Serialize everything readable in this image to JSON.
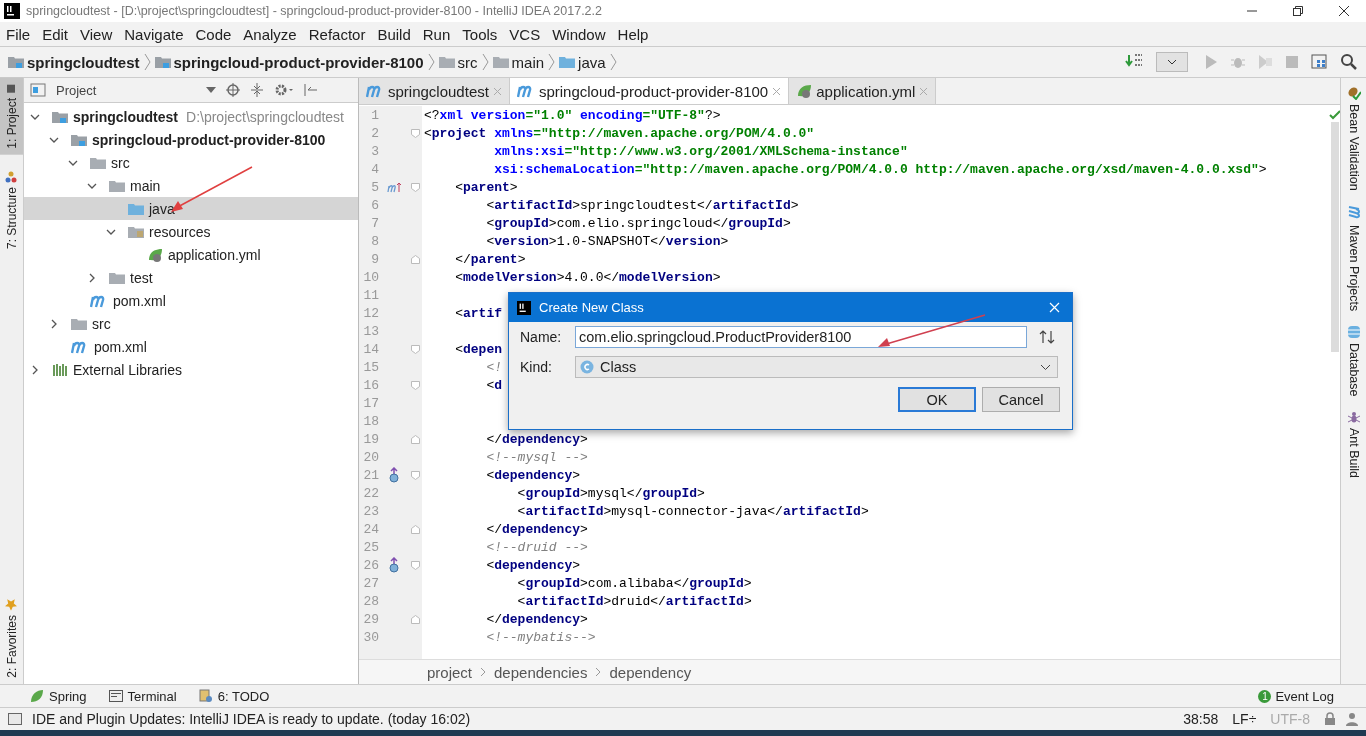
{
  "window": {
    "title": "springcloudtest - [D:\\project\\springcloudtest] - springcloud-product-provider-8100 - IntelliJ IDEA 2017.2.2"
  },
  "menu": [
    "File",
    "Edit",
    "View",
    "Navigate",
    "Code",
    "Analyze",
    "Refactor",
    "Build",
    "Run",
    "Tools",
    "VCS",
    "Window",
    "Help"
  ],
  "breadcrumbs": [
    {
      "label": "springcloudtest",
      "kind": "module"
    },
    {
      "label": "springcloud-product-provider-8100",
      "kind": "module"
    },
    {
      "label": "src",
      "kind": "folder"
    },
    {
      "label": "main",
      "kind": "folder"
    },
    {
      "label": "java",
      "kind": "source"
    }
  ],
  "left_stripe": {
    "top": [
      {
        "label": "1: Project",
        "selected": true,
        "kind": "project"
      },
      {
        "label": "7: Structure",
        "selected": false,
        "kind": "structure"
      }
    ],
    "bottom": [
      {
        "label": "2: Favorites",
        "selected": false,
        "kind": "favorites"
      }
    ]
  },
  "project": {
    "title": "Project",
    "tree": [
      {
        "label": "springcloudtest",
        "kind": "module",
        "path": "D:\\project\\springcloudtest",
        "expanded": true,
        "selected": false,
        "children": [
          {
            "label": "springcloud-product-provider-8100",
            "kind": "module",
            "expanded": true,
            "selected": false,
            "children": [
              {
                "label": "src",
                "kind": "folder",
                "expanded": true,
                "selected": false,
                "children": [
                  {
                    "label": "main",
                    "kind": "folder",
                    "expanded": true,
                    "selected": false,
                    "children": [
                      {
                        "label": "java",
                        "kind": "source",
                        "selected": true
                      },
                      {
                        "label": "resources",
                        "kind": "resources",
                        "expanded": true,
                        "selected": false,
                        "children": [
                          {
                            "label": "application.yml",
                            "kind": "yml",
                            "selected": false
                          }
                        ]
                      }
                    ]
                  },
                  {
                    "label": "test",
                    "kind": "folder",
                    "expanded": false,
                    "selected": false
                  }
                ]
              },
              {
                "label": "pom.xml",
                "kind": "pom",
                "selected": false
              }
            ]
          },
          {
            "label": "src",
            "kind": "folder",
            "expanded": false,
            "selected": false
          },
          {
            "label": "pom.xml",
            "kind": "pom",
            "selected": false
          }
        ]
      },
      {
        "label": "External Libraries",
        "kind": "libraries",
        "expanded": false,
        "selected": false
      }
    ]
  },
  "editor": {
    "tabs": [
      {
        "label": "springcloudtest",
        "kind": "pom",
        "selected": false
      },
      {
        "label": "springcloud-product-provider-8100",
        "kind": "pom",
        "selected": true
      },
      {
        "label": "application.yml",
        "kind": "yml",
        "selected": false
      }
    ],
    "lines": [
      {
        "n": "1",
        "kind": "code",
        "segs": [
          {
            "kind": "plain",
            "text": "<?"
          },
          {
            "kind": "attr",
            "text": "xml version"
          },
          {
            "kind": "value",
            "text": "=\"1.0\" "
          },
          {
            "kind": "attr",
            "text": "encoding"
          },
          {
            "kind": "value",
            "text": "=\"UTF-8\""
          },
          {
            "kind": "plain",
            "text": "?>"
          }
        ]
      },
      {
        "n": "2",
        "kind": "code",
        "fold_start": true,
        "segs": [
          {
            "kind": "plain",
            "text": "<"
          },
          {
            "kind": "tag",
            "text": "project "
          },
          {
            "kind": "attr",
            "text": "xmlns"
          },
          {
            "kind": "value",
            "text": "=\"http://maven.apache.org/POM/4.0.0\""
          }
        ]
      },
      {
        "n": "3",
        "kind": "code",
        "segs": [
          {
            "kind": "attr",
            "text": "         xmlns:xsi"
          },
          {
            "kind": "value",
            "text": "=\"http://www.w3.org/2001/XMLSchema-instance\""
          }
        ]
      },
      {
        "n": "4",
        "kind": "code",
        "segs": [
          {
            "kind": "attr",
            "text": "         xsi:schemaLocation"
          },
          {
            "kind": "value",
            "text": "=\"http://maven.apache.org/POM/4.0.0 http://maven.apache.org/xsd/maven-4.0.0.xsd\""
          },
          {
            "kind": "plain",
            "text": ">"
          }
        ]
      },
      {
        "n": "5",
        "kind": "parent",
        "fold_start": true,
        "segs": [
          {
            "kind": "plain",
            "text": "    <"
          },
          {
            "kind": "tag",
            "text": "parent"
          },
          {
            "kind": "plain",
            "text": ">"
          }
        ]
      },
      {
        "n": "6",
        "kind": "code",
        "segs": [
          {
            "kind": "plain",
            "text": "        <"
          },
          {
            "kind": "tag",
            "text": "artifactId"
          },
          {
            "kind": "plain",
            "text": ">springcloudtest</"
          },
          {
            "kind": "tag",
            "text": "artifactId"
          },
          {
            "kind": "plain",
            "text": ">"
          }
        ]
      },
      {
        "n": "7",
        "kind": "code",
        "segs": [
          {
            "kind": "plain",
            "text": "        <"
          },
          {
            "kind": "tag",
            "text": "groupId"
          },
          {
            "kind": "plain",
            "text": ">com.elio.springcloud</"
          },
          {
            "kind": "tag",
            "text": "groupId"
          },
          {
            "kind": "plain",
            "text": ">"
          }
        ]
      },
      {
        "n": "8",
        "kind": "code",
        "segs": [
          {
            "kind": "plain",
            "text": "        <"
          },
          {
            "kind": "tag",
            "text": "version"
          },
          {
            "kind": "plain",
            "text": ">1.0-SNAPSHOT</"
          },
          {
            "kind": "tag",
            "text": "version"
          },
          {
            "kind": "plain",
            "text": ">"
          }
        ]
      },
      {
        "n": "9",
        "kind": "code",
        "fold_end": true,
        "segs": [
          {
            "kind": "plain",
            "text": "    </"
          },
          {
            "kind": "tag",
            "text": "parent"
          },
          {
            "kind": "plain",
            "text": ">"
          }
        ]
      },
      {
        "n": "10",
        "kind": "code",
        "segs": [
          {
            "kind": "plain",
            "text": "    <"
          },
          {
            "kind": "tag",
            "text": "modelVersion"
          },
          {
            "kind": "plain",
            "text": ">4.0.0</"
          },
          {
            "kind": "tag",
            "text": "modelVersion"
          },
          {
            "kind": "plain",
            "text": ">"
          }
        ]
      },
      {
        "n": "11",
        "kind": "code"
      },
      {
        "n": "12",
        "kind": "code",
        "segs": [
          {
            "kind": "plain",
            "text": "    <"
          },
          {
            "kind": "tag",
            "text": "artif"
          }
        ]
      },
      {
        "n": "13",
        "kind": "code"
      },
      {
        "n": "14",
        "kind": "code",
        "fold_start": true,
        "segs": [
          {
            "kind": "plain",
            "text": "    <"
          },
          {
            "kind": "tag",
            "text": "depen"
          }
        ]
      },
      {
        "n": "15",
        "kind": "code",
        "segs": [
          {
            "kind": "comment",
            "text": "        <!"
          }
        ]
      },
      {
        "n": "16",
        "kind": "code",
        "fold_start": true,
        "segs": [
          {
            "kind": "plain",
            "text": "        <"
          },
          {
            "kind": "tag",
            "text": "d"
          }
        ]
      },
      {
        "n": "17",
        "kind": "code"
      },
      {
        "n": "18",
        "kind": "code"
      },
      {
        "n": "19",
        "kind": "code",
        "fold_end": true,
        "segs": [
          {
            "kind": "plain",
            "text": "        </"
          },
          {
            "kind": "tag",
            "text": "dependency"
          },
          {
            "kind": "plain",
            "text": ">"
          }
        ]
      },
      {
        "n": "20",
        "kind": "code",
        "segs": [
          {
            "kind": "comment",
            "text": "        <!--mysql -->"
          }
        ]
      },
      {
        "n": "21",
        "kind": "override",
        "fold_start": true,
        "segs": [
          {
            "kind": "plain",
            "text": "        <"
          },
          {
            "kind": "tag",
            "text": "dependency"
          },
          {
            "kind": "plain",
            "text": ">"
          }
        ]
      },
      {
        "n": "22",
        "kind": "code",
        "segs": [
          {
            "kind": "plain",
            "text": "            <"
          },
          {
            "kind": "tag",
            "text": "groupId"
          },
          {
            "kind": "plain",
            "text": ">mysql</"
          },
          {
            "kind": "tag",
            "text": "groupId"
          },
          {
            "kind": "plain",
            "text": ">"
          }
        ]
      },
      {
        "n": "23",
        "kind": "code",
        "segs": [
          {
            "kind": "plain",
            "text": "            <"
          },
          {
            "kind": "tag",
            "text": "artifactId"
          },
          {
            "kind": "plain",
            "text": ">mysql-connector-java</"
          },
          {
            "kind": "tag",
            "text": "artifactId"
          },
          {
            "kind": "plain",
            "text": ">"
          }
        ]
      },
      {
        "n": "24",
        "kind": "code",
        "fold_end": true,
        "segs": [
          {
            "kind": "plain",
            "text": "        </"
          },
          {
            "kind": "tag",
            "text": "dependency"
          },
          {
            "kind": "plain",
            "text": ">"
          }
        ]
      },
      {
        "n": "25",
        "kind": "code",
        "segs": [
          {
            "kind": "comment",
            "text": "        <!--druid -->"
          }
        ]
      },
      {
        "n": "26",
        "kind": "override",
        "fold_start": true,
        "segs": [
          {
            "kind": "plain",
            "text": "        <"
          },
          {
            "kind": "tag",
            "text": "dependency"
          },
          {
            "kind": "plain",
            "text": ">"
          }
        ]
      },
      {
        "n": "27",
        "kind": "code",
        "segs": [
          {
            "kind": "plain",
            "text": "            <"
          },
          {
            "kind": "tag",
            "text": "groupId"
          },
          {
            "kind": "plain",
            "text": ">com.alibaba</"
          },
          {
            "kind": "tag",
            "text": "groupId"
          },
          {
            "kind": "plain",
            "text": ">"
          }
        ]
      },
      {
        "n": "28",
        "kind": "code",
        "segs": [
          {
            "kind": "plain",
            "text": "            <"
          },
          {
            "kind": "tag",
            "text": "artifactId"
          },
          {
            "kind": "plain",
            "text": ">druid</"
          },
          {
            "kind": "tag",
            "text": "artifactId"
          },
          {
            "kind": "plain",
            "text": ">"
          }
        ]
      },
      {
        "n": "29",
        "kind": "code",
        "fold_end": true,
        "segs": [
          {
            "kind": "plain",
            "text": "        </"
          },
          {
            "kind": "tag",
            "text": "dependency"
          },
          {
            "kind": "plain",
            "text": ">"
          }
        ]
      },
      {
        "n": "30",
        "kind": "code",
        "segs": [
          {
            "kind": "comment",
            "text": "        <!--mybatis-->"
          }
        ]
      }
    ],
    "path": [
      "project",
      "dependencies",
      "dependency"
    ]
  },
  "right_stripe": [
    {
      "label": "Bean Validation",
      "kind": "bean"
    },
    {
      "label": "Maven Projects",
      "kind": "maven"
    },
    {
      "label": "Database",
      "kind": "database"
    },
    {
      "label": "Ant Build",
      "kind": "ant"
    }
  ],
  "tool_tabs": [
    {
      "label": "Spring",
      "kind": "spring"
    },
    {
      "label": "Terminal",
      "kind": "terminal"
    },
    {
      "label": "6: TODO",
      "kind": "todo"
    }
  ],
  "event_log": {
    "label": "Event Log",
    "count": "1"
  },
  "status": {
    "message": "IDE and Plugin Updates: IntelliJ IDEA is ready to update. (today 16:02)",
    "position": "38:58",
    "line_sep": "LF÷",
    "encoding": "UTF-8"
  },
  "dialog": {
    "title": "Create New Class",
    "name_label": "Name:",
    "name_value": "com.elio.springcloud.ProductProvider8100",
    "kind_label": "Kind:",
    "kind_value": "Class",
    "buttons": [
      {
        "label": "OK",
        "kind": "default"
      },
      {
        "label": "Cancel",
        "kind": "normal"
      }
    ]
  }
}
